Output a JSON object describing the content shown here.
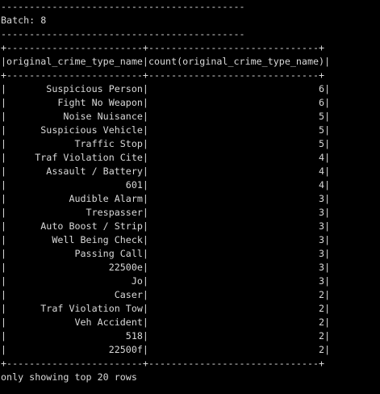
{
  "terminal": {
    "header_rule": "-------------------------------------------",
    "batch_label": "Batch: 8",
    "border": "+------------------------+------------------------------+",
    "columns": [
      "original_crime_type_name",
      "count(original_crime_type_name)"
    ],
    "rows": [
      {
        "name": "Suspicious Person",
        "count": "6"
      },
      {
        "name": "Fight No Weapon",
        "count": "6"
      },
      {
        "name": "Noise Nuisance",
        "count": "5"
      },
      {
        "name": "Suspicious Vehicle",
        "count": "5"
      },
      {
        "name": "Traffic Stop",
        "count": "5"
      },
      {
        "name": "Traf Violation Cite",
        "count": "4"
      },
      {
        "name": "Assault / Battery",
        "count": "4"
      },
      {
        "name": "601",
        "count": "4"
      },
      {
        "name": "Audible Alarm",
        "count": "3"
      },
      {
        "name": "Trespasser",
        "count": "3"
      },
      {
        "name": "Auto Boost / Strip",
        "count": "3"
      },
      {
        "name": "Well Being Check",
        "count": "3"
      },
      {
        "name": "Passing Call",
        "count": "3"
      },
      {
        "name": "22500e",
        "count": "3"
      },
      {
        "name": "Jo",
        "count": "3"
      },
      {
        "name": "Caser",
        "count": "2"
      },
      {
        "name": "Traf Violation Tow",
        "count": "2"
      },
      {
        "name": "Veh Accident",
        "count": "2"
      },
      {
        "name": "518",
        "count": "2"
      },
      {
        "name": "22500f",
        "count": "2"
      }
    ],
    "footer": "only showing top 20 rows"
  }
}
